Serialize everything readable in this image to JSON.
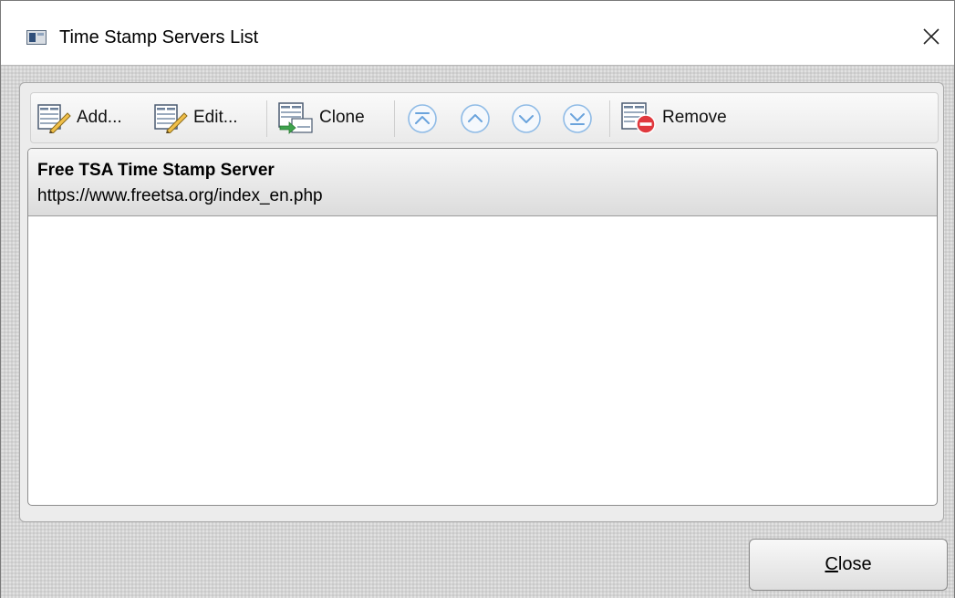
{
  "window": {
    "title": "Time Stamp Servers List",
    "close_glyph": "✕"
  },
  "toolbar": {
    "add_label": "Add...",
    "edit_label": "Edit...",
    "clone_label": "Clone",
    "remove_label": "Remove",
    "nav_icons": [
      "move-to-top-icon",
      "move-up-icon",
      "move-down-icon",
      "move-to-bottom-icon"
    ]
  },
  "servers": [
    {
      "name": "Free TSA Time Stamp Server",
      "url": "https://www.freetsa.org/index_en.php"
    }
  ],
  "footer": {
    "close_accel": "C",
    "close_rest": "lose"
  },
  "colors": {
    "nav_icon": "#6aa3dc",
    "remove_badge": "#e0393e",
    "clone_arrow": "#3fa34d"
  }
}
